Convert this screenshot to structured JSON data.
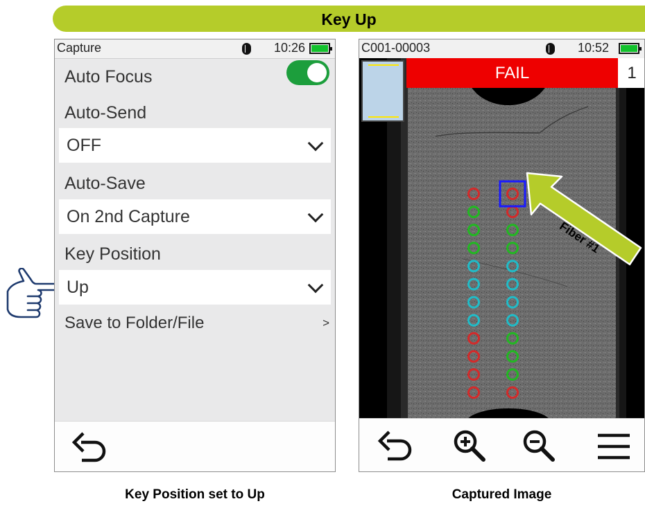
{
  "banner": {
    "title": "Key Up"
  },
  "left_device": {
    "status": {
      "title": "Capture",
      "time": "10:26"
    },
    "auto_focus": {
      "label": "Auto Focus",
      "enabled": true
    },
    "auto_send": {
      "label": "Auto-Send",
      "value": "OFF"
    },
    "auto_save": {
      "label": "Auto-Save",
      "value": "On 2nd Capture"
    },
    "key_position": {
      "label": "Key Position",
      "value": "Up"
    },
    "save_to": {
      "label": "Save to Folder/File",
      "arrow": ">"
    }
  },
  "right_device": {
    "status": {
      "title": "C001-00003",
      "time": "10:52"
    },
    "result": {
      "label": "FAIL",
      "fiber_index": "1"
    },
    "annotation": {
      "label": "Fiber #1"
    },
    "fiber_columns": [
      [
        "red",
        "green",
        "green",
        "green",
        "cyan",
        "cyan",
        "cyan",
        "cyan",
        "red",
        "red",
        "red",
        "red"
      ],
      [
        "red",
        "red",
        "green",
        "green",
        "cyan",
        "cyan",
        "cyan",
        "cyan",
        "green",
        "green",
        "green",
        "red"
      ]
    ],
    "colors": {
      "red": "#d42a2a",
      "green": "#22b822",
      "cyan": "#20bcc8",
      "highlight": "#1a1aff",
      "fail": "#ee0000",
      "accent": "#b5cc2a"
    }
  },
  "captions": {
    "left": "Key Position set to Up",
    "right": "Captured Image"
  }
}
